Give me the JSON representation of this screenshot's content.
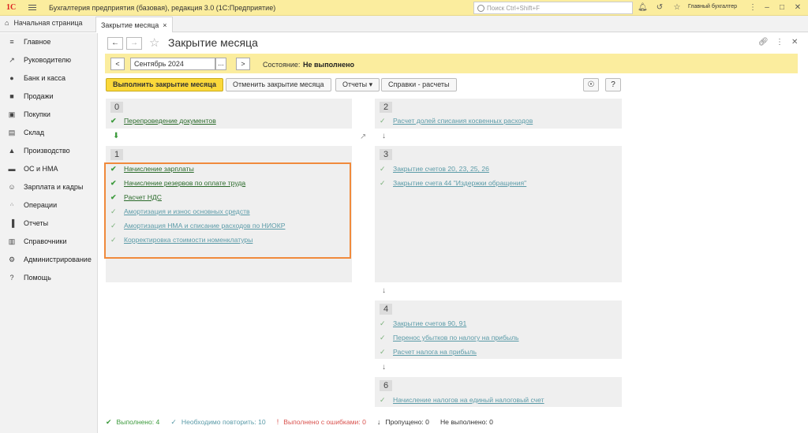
{
  "app": {
    "logo": "1С",
    "title": "Бухгалтерия предприятия (базовая), редакция 3.0  (1С:Предприятие)",
    "search_placeholder": "Поиск Ctrl+Shift+F",
    "user": "Главный бухгалтер"
  },
  "tabs": {
    "home": "Начальная страница",
    "active": "Закрытие месяца",
    "close": "×"
  },
  "sidebar": {
    "items": [
      {
        "label": "Главное",
        "icon": "menu-icon"
      },
      {
        "label": "Руководителю",
        "icon": "trend-icon"
      },
      {
        "label": "Банк и касса",
        "icon": "coin-icon"
      },
      {
        "label": "Продажи",
        "icon": "bag-icon"
      },
      {
        "label": "Покупки",
        "icon": "basket-icon"
      },
      {
        "label": "Склад",
        "icon": "box-icon"
      },
      {
        "label": "Производство",
        "icon": "factory-icon"
      },
      {
        "label": "ОС и НМА",
        "icon": "truck-icon"
      },
      {
        "label": "Зарплата и кадры",
        "icon": "person-icon"
      },
      {
        "label": "Операции",
        "icon": "dt-kt-icon"
      },
      {
        "label": "Отчеты",
        "icon": "chart-icon"
      },
      {
        "label": "Справочники",
        "icon": "book-icon"
      },
      {
        "label": "Администрирование",
        "icon": "gear-icon"
      },
      {
        "label": "Помощь",
        "icon": "question-icon"
      }
    ]
  },
  "page": {
    "title": "Закрытие месяца",
    "period_value": "Сентябрь 2024",
    "prev": "<",
    "next": ">",
    "dots": "...",
    "state_label": "Состояние:",
    "state_value": "Не выполнено"
  },
  "actions": {
    "run": "Выполнить закрытие месяца",
    "cancel": "Отменить закрытие месяца",
    "reports": "Отчеты",
    "help_calc": "Справки - расчеты",
    "question": "?"
  },
  "stages": [
    {
      "num": "0",
      "ops": [
        {
          "label": "Перепроведение документов",
          "done": true
        }
      ]
    },
    {
      "num": "1",
      "ops": [
        {
          "label": "Начисление зарплаты",
          "done": true
        },
        {
          "label": "Начисление резервов по оплате труда",
          "done": true
        },
        {
          "label": "Расчет НДС",
          "done": true
        },
        {
          "label": "Амортизация и износ основных средств",
          "done": false
        },
        {
          "label": "Амортизация НМА и списание расходов по НИОКР",
          "done": false
        },
        {
          "label": "Корректировка стоимости номенклатуры",
          "done": false
        }
      ]
    },
    {
      "num": "2",
      "ops": [
        {
          "label": "Расчет долей списания косвенных расходов",
          "done": false
        }
      ]
    },
    {
      "num": "3",
      "ops": [
        {
          "label": "Закрытие счетов 20, 23, 25, 26",
          "done": false
        },
        {
          "label": "Закрытие счета 44 \"Издержки обращения\"",
          "done": false
        }
      ]
    },
    {
      "num": "4",
      "ops": [
        {
          "label": "Закрытие счетов 90, 91",
          "done": false
        },
        {
          "label": "Перенос убытков по налогу на прибыль",
          "done": false
        },
        {
          "label": "Расчет налога на прибыль",
          "done": false
        }
      ]
    },
    {
      "num": "6",
      "ops": [
        {
          "label": "Начисление налогов на единый налоговый счет",
          "done": false
        }
      ]
    }
  ],
  "status": {
    "done": "Выполнено: 4",
    "repeat": "Необходимо повторить: 10",
    "errors": "Выполнено с ошибками: 0",
    "skipped": "Пропущено: 0",
    "not_done": "Не выполнено: 0"
  },
  "colors": {
    "accent_yellow": "#fbed9e",
    "primary_button": "#fbd83a",
    "done_green": "#3c9a3c",
    "repeat_teal": "#5b9ba8",
    "error_red": "#d9534f",
    "highlight_orange": "#f08a3c"
  }
}
